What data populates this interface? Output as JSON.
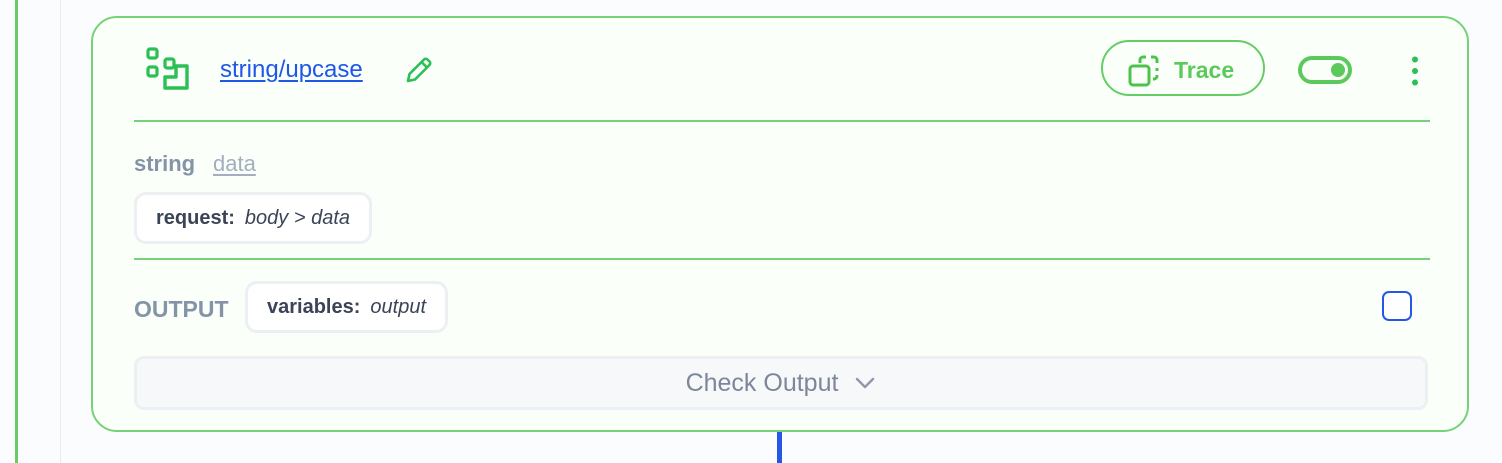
{
  "module": {
    "link_text": "string/upcase",
    "icon": "module-steps-icon",
    "edit_icon": "pencil-icon"
  },
  "toolbar": {
    "trace_label": "Trace",
    "trace_icon": "copy-dashed-icon",
    "toggle_state": "on",
    "menu_icon": "kebab-menu-icon"
  },
  "input": {
    "param_name": "string",
    "param_type": "data",
    "source_key": "request:",
    "source_value": "body > data"
  },
  "output": {
    "label": "OUTPUT",
    "target_key": "variables:",
    "target_value": "output",
    "checkbox_checked": false,
    "check_button_label": "Check Output"
  },
  "colors": {
    "accent_green": "#66cd66",
    "link_blue": "#1f57e8",
    "muted_text": "#8593a8"
  }
}
